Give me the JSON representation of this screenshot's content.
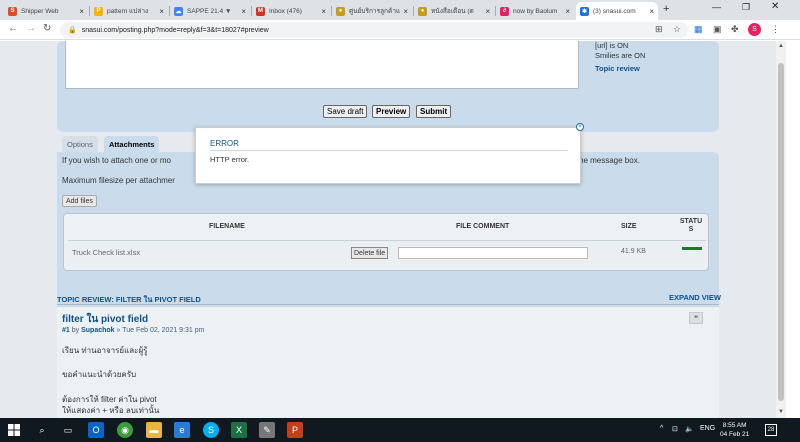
{
  "browser": {
    "tabs": [
      {
        "label": "Shipper Web",
        "color": "#e34c26",
        "glyph": "S"
      },
      {
        "label": "pattern แปล่าง",
        "color": "#f4b400",
        "glyph": "P"
      },
      {
        "label": "SAPPE 21.4 ▼",
        "color": "#4285f4",
        "glyph": "☁"
      },
      {
        "label": "Inbox (476)",
        "color": "#d93025",
        "glyph": "M"
      },
      {
        "label": "ศูนย์บริการลูกค้าแ",
        "color": "#c89b1a",
        "glyph": "●"
      },
      {
        "label": "หนังสือเตือน (ต",
        "color": "#c89b1a",
        "glyph": "●"
      },
      {
        "label": "now by Baolum",
        "color": "#e91e63",
        "glyph": "∂"
      },
      {
        "label": "(3) snasui.com",
        "color": "#1a73e8",
        "glyph": "✱"
      }
    ],
    "close_glyph": "×",
    "new_tab": "+",
    "url": "snasui.com/posting.php?mode=reply&f=3&t=18027#preview",
    "avatar_letter": "S"
  },
  "page": {
    "sidebar_lines": [
      "[url] is ON",
      "Smilies are ON"
    ],
    "topic_review_link": "Topic review",
    "buttons": {
      "save_draft": "Save draft",
      "preview": "Preview",
      "submit": "Submit"
    },
    "tabs": {
      "options": "Options",
      "attachments": "Attachments"
    },
    "attach_note": "If you wish to attach one or mo",
    "attach_note_tail": "he message box.",
    "max_filesize": "Maximum filesize per attachmer",
    "add_files": "Add files",
    "table_headers": {
      "filename": "FILENAME",
      "comment": "FILE COMMENT",
      "size": "SIZE",
      "status": "STATU S"
    },
    "file": {
      "name": "Truck Check list.xlsx",
      "delete": "Delete file",
      "size": "41.9 KB",
      "progress_pct": 100
    },
    "review_heading": "TOPIC REVIEW: FILTER ใน PIVOT FIELD",
    "expand_view": "EXPAND VIEW",
    "post": {
      "title": "filter ใน pivot field",
      "id": "#1",
      "by": "by",
      "author": "Supachok",
      "date": "» Tue Feb 02, 2021 9:31 pm",
      "quote_glyph": "❝",
      "lines": [
        "เรียน ท่านอาจารย์และผู้รู้",
        "ขอคำแนะนำด้วยครับ",
        "ต้องการให้ filter ค่าใน pivot",
        "ให้แสดงค่า + หรือ ลบเท่านั้น"
      ]
    }
  },
  "modal": {
    "title": "ERROR",
    "message": "HTTP error.",
    "close": "×"
  },
  "taskbar": {
    "time": "8:55 AM",
    "date": "04 Feb 21",
    "lang": "ENG",
    "notifications": "28",
    "apps": [
      {
        "name": "outlook",
        "color": "#0a64c8",
        "glyph": "O"
      },
      {
        "name": "chrome",
        "color": "#3a9c3a",
        "glyph": "◉"
      },
      {
        "name": "file-explorer",
        "color": "#e8b73b",
        "glyph": "▬"
      },
      {
        "name": "edge",
        "color": "#2b7bd6",
        "glyph": "e"
      },
      {
        "name": "skype",
        "color": "#00aff0",
        "glyph": "S"
      },
      {
        "name": "excel",
        "color": "#1d7044",
        "glyph": "X"
      },
      {
        "name": "paint",
        "color": "#777777",
        "glyph": "✎"
      },
      {
        "name": "powerpoint",
        "color": "#c43e1c",
        "glyph": "P"
      }
    ]
  }
}
